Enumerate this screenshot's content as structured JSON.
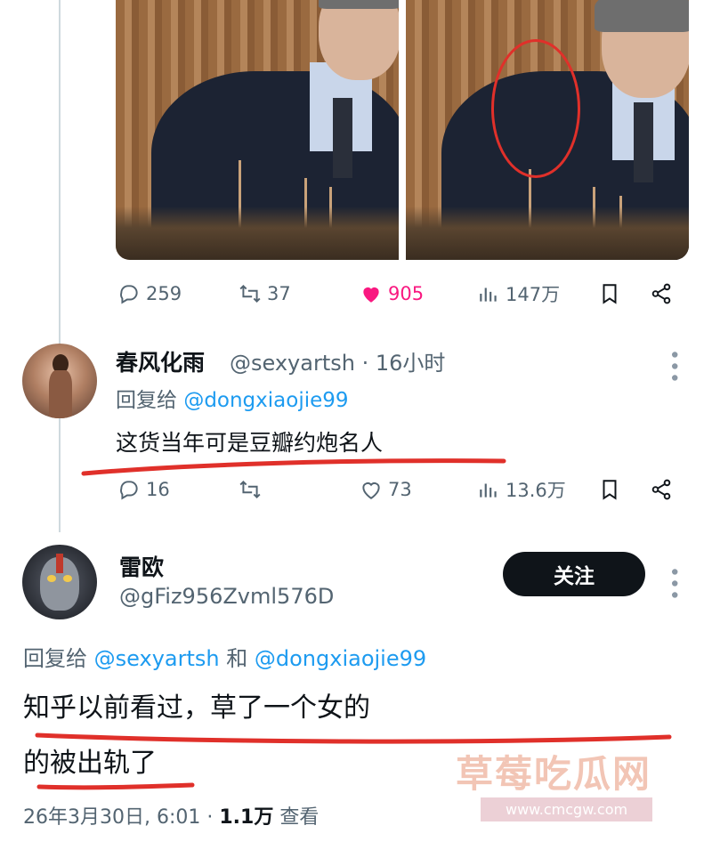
{
  "first_tweet": {
    "stats": {
      "replies": "259",
      "retweets": "37",
      "likes": "905",
      "views": "147万"
    }
  },
  "reply1": {
    "name": "春风化雨",
    "handle": "@sexyartsh",
    "time": "· 16小时",
    "reply_prefix": "回复给",
    "reply_mention": "@dongxiaojie99",
    "text": "这货当年可是豆瓣约炮名人",
    "stats": {
      "replies": "16",
      "retweets": "",
      "likes": "73",
      "views": "13.6万"
    }
  },
  "reply2": {
    "name": "雷欧",
    "handle": "@gFiz956Zvml576D",
    "follow_label": "关注",
    "reply_prefix": "回复给",
    "reply_mention1": "@sexyartsh",
    "reply_and": "和",
    "reply_mention2": "@dongxiaojie99",
    "text_line1": "知乎以前看过，草了一个女的",
    "text_line2": "的被出轨了",
    "date": "26年3月30日, 6:01 · ",
    "views": "1.1万",
    "views_suffix": " 查看"
  },
  "watermark": {
    "text": "草莓吃瓜网",
    "url": "www.cmcgw.com"
  },
  "colors": {
    "like_pink": "#f91880",
    "mention_blue": "#1d9bf0",
    "annotation_red": "#e0302a"
  }
}
